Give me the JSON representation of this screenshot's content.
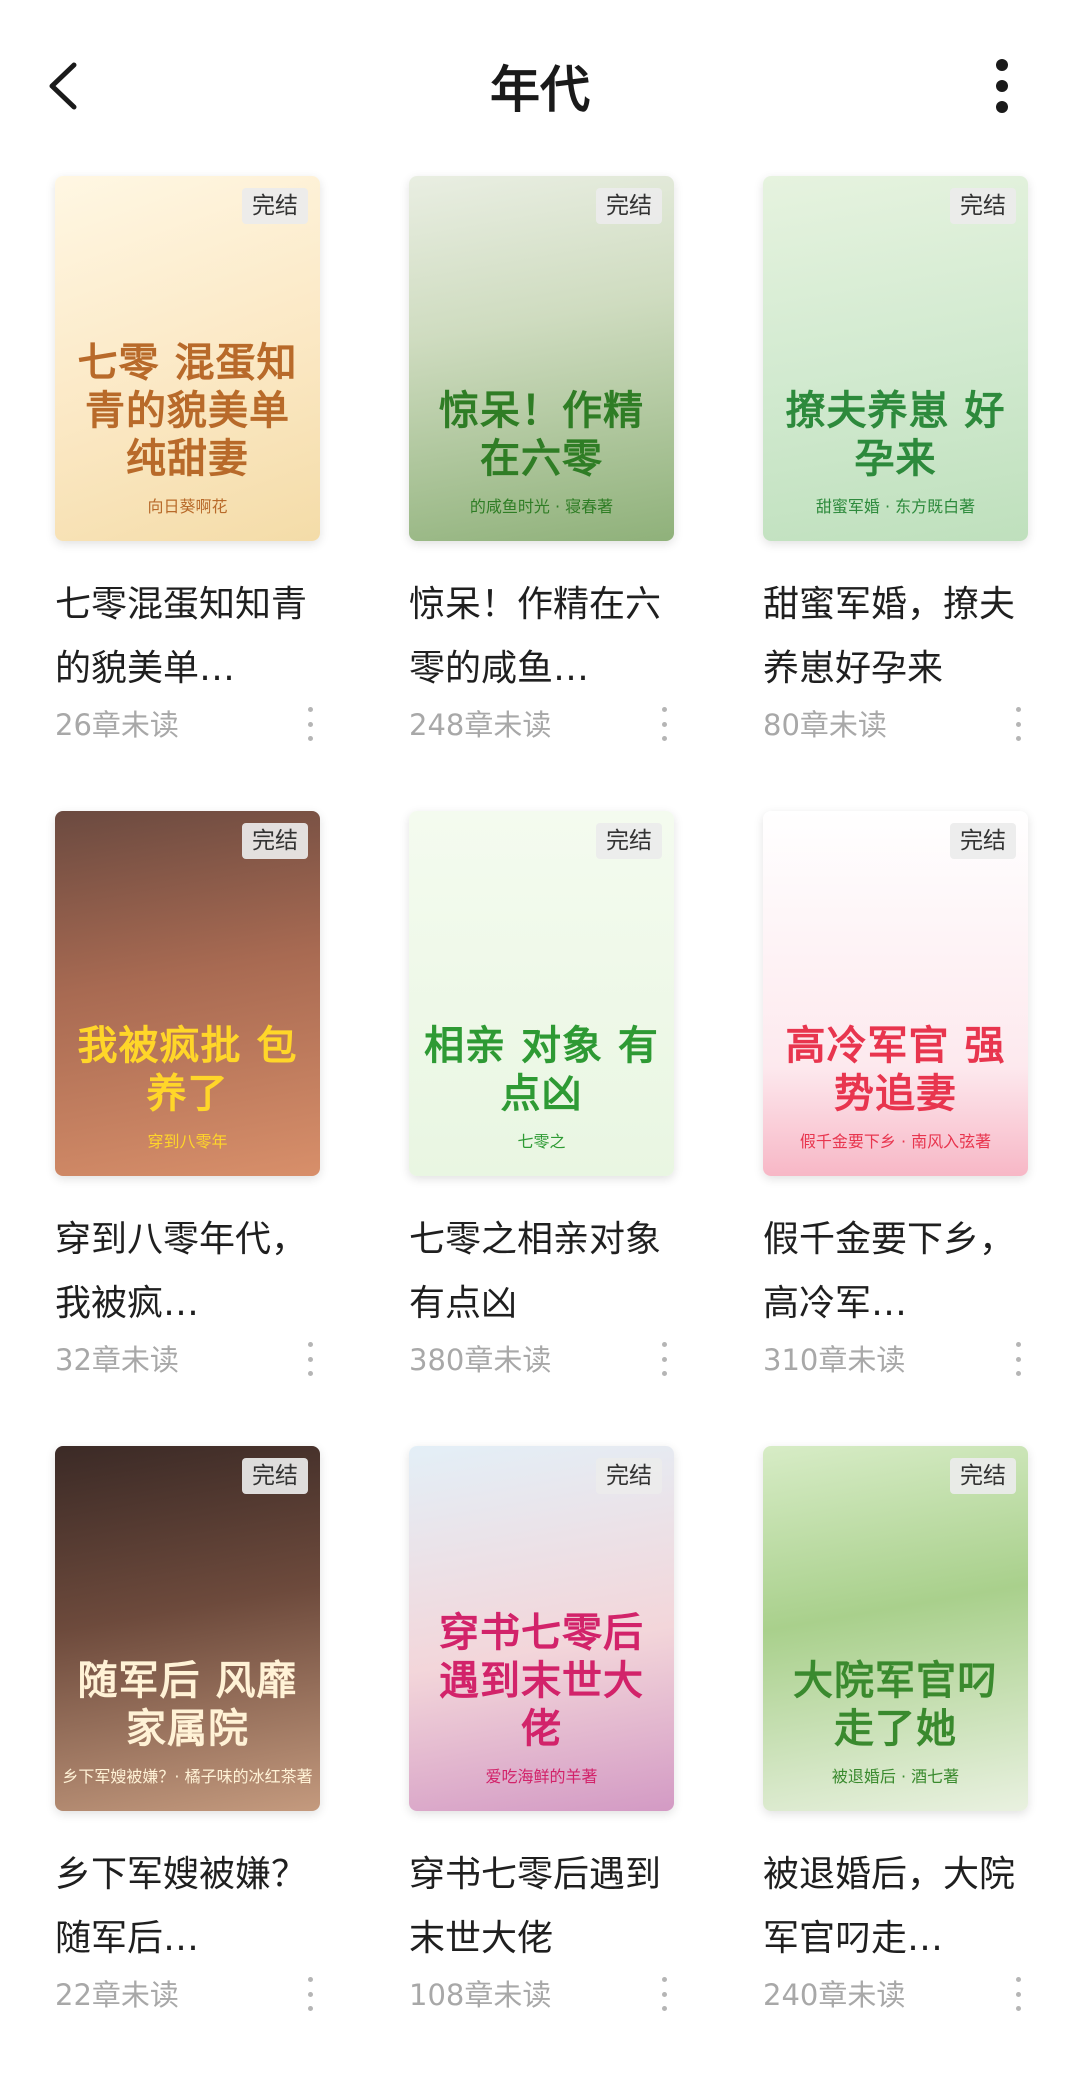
{
  "header": {
    "title": "年代",
    "back_icon": "chevron-left-icon",
    "more_icon": "more-vertical-icon"
  },
  "books": [
    {
      "title": "七零混蛋知知青的貌美单…",
      "status": "完结",
      "unread": "26章未读",
      "cover": {
        "title": "七零 混蛋知青的貌美单纯甜妻",
        "author": "向日葵啊花",
        "bg": "linear-gradient(160deg,#fff7e3 0%,#fbe8c4 55%,#f4dca8 100%)",
        "fg": "#b86a2a"
      }
    },
    {
      "title": "惊呆！作精在六零的咸鱼…",
      "status": "完结",
      "unread": "248章未读",
      "cover": {
        "title": "惊呆！作精在六零",
        "author": "的咸鱼时光 · 寝春著",
        "bg": "linear-gradient(170deg,#e9eee2 0%,#cfdcc0 40%,#8fb17a 100%)",
        "fg": "#2f7d25"
      }
    },
    {
      "title": "甜蜜军婚，撩夫养崽好孕来",
      "status": "完结",
      "unread": "80章未读",
      "cover": {
        "title": "撩夫养崽 好孕来",
        "author": "甜蜜军婚 · 东方既白著",
        "bg": "linear-gradient(170deg,#e6f3df 0%,#d2ead0 50%,#bfe0bd 100%)",
        "fg": "#2d8a3c"
      }
    },
    {
      "title": "穿到八零年代，我被疯…",
      "status": "完结",
      "unread": "32章未读",
      "cover": {
        "title": "我被疯批 包养了",
        "author": "穿到八零年",
        "bg": "linear-gradient(170deg,#6b4a40 0%,#a86a52 45%,#d88f6a 100%)",
        "fg": "#ffd629"
      }
    },
    {
      "title": "七零之相亲对象有点凶",
      "status": "完结",
      "unread": "380章未读",
      "cover": {
        "title": "相亲 对象 有点凶",
        "author": "七零之",
        "bg": "linear-gradient(180deg,#f4fbef 0%,#e9f6e2 100%)",
        "fg": "#2e9a34"
      }
    },
    {
      "title": "假千金要下乡，高冷军…",
      "status": "完结",
      "unread": "310章未读",
      "cover": {
        "title": "高冷军官 强势追妻",
        "author": "假千金要下乡 · 南风入弦著",
        "bg": "linear-gradient(180deg,#ffffff 0%,#fde9ee 70%,#f7b7c6 100%)",
        "fg": "#e8354e"
      }
    },
    {
      "title": "乡下军嫂被嫌？随军后…",
      "status": "完结",
      "unread": "22章未读",
      "cover": {
        "title": "随军后 风靡家属院",
        "author": "乡下军嫂被嫌？· 橘子味的冰红茶著",
        "bg": "linear-gradient(170deg,#3b2a26 0%,#6d4a3c 45%,#c49a7e 100%)",
        "fg": "#fff2d6"
      }
    },
    {
      "title": "穿书七零后遇到末世大佬",
      "status": "完结",
      "unread": "108章未读",
      "cover": {
        "title": "穿书七零后 遇到末世大佬",
        "author": "爱吃海鲜的羊著",
        "bg": "linear-gradient(170deg,#e3eff7 0%,#f3d6da 55%,#d39ac4 100%)",
        "fg": "#d2236a"
      }
    },
    {
      "title": "被退婚后，大院军官叼走…",
      "status": "完结",
      "unread": "240章未读",
      "cover": {
        "title": "大院军官叼 走了她",
        "author": "被退婚后 · 酒七著",
        "bg": "linear-gradient(170deg,#d7ecc6 0%,#a9d08c 45%,#e9f1e0 100%)",
        "fg": "#3a8a2e"
      }
    }
  ],
  "icons": {
    "card_more": "more-vertical-icon"
  }
}
